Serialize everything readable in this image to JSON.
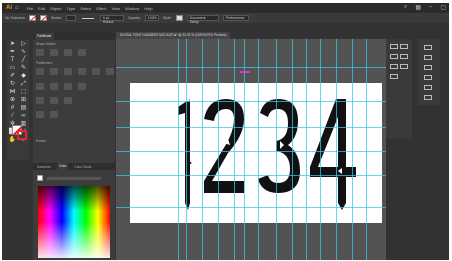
{
  "app": {
    "logo": "Ai",
    "menus": [
      "File",
      "Edit",
      "Object",
      "Type",
      "Select",
      "Effect",
      "View",
      "Window",
      "Help"
    ]
  },
  "control_bar": {
    "selection_label": "No Selection",
    "stroke_label": "Stroke:",
    "brush": "5 pt. Round",
    "opacity_label": "Opacity:",
    "opacity_value": "100%",
    "style_label": "Style:",
    "doc_setup": "Document Setup",
    "preferences": "Preferences"
  },
  "panels": {
    "tabs_top": [
      "Pathfinder"
    ],
    "shape_modes": "Shape Modes:",
    "pathfinders": "Pathfinders:",
    "tabs_bottom": [
      "Swatches",
      "Color",
      "Color Guide"
    ],
    "embed_label": "Embed"
  },
  "document": {
    "tab_title": "DIGITAL FONT NUMBERS MOCKUP.ai* @ 33.33 % (CMYK/GPU Preview)"
  },
  "artwork": {
    "text": "1234"
  },
  "colors": {
    "guide": "#35c9e8",
    "accent": "#ff9a00",
    "artboard": "#ffffff",
    "glyph": "#111111"
  }
}
